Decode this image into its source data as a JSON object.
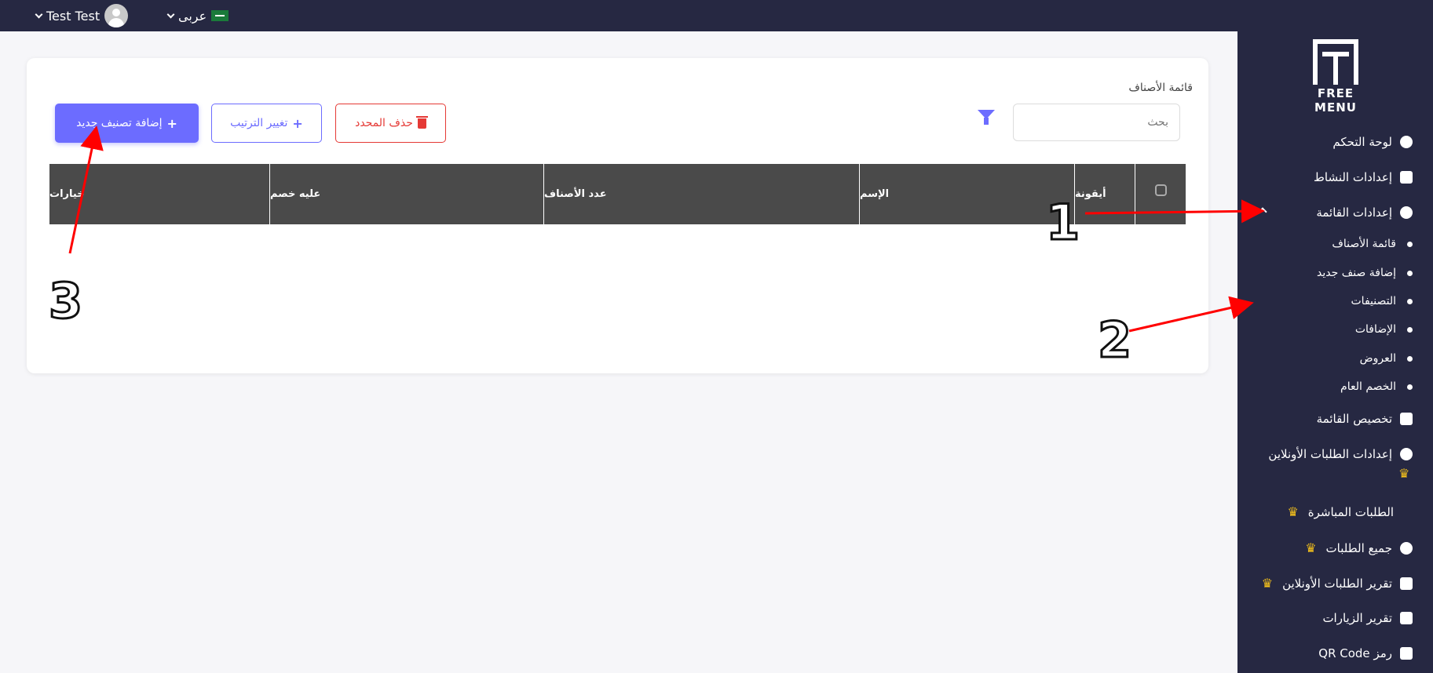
{
  "topbar": {
    "user_name": "Test Test",
    "language": "عربى"
  },
  "sidebar": {
    "logo_text_line1": "FREE",
    "logo_text_line2": "MENU",
    "items": [
      {
        "label": "لوحة التحكم",
        "icon": "dashboard-icon"
      },
      {
        "label": "إعدادات النشاط",
        "icon": "briefcase-icon"
      },
      {
        "label": "إعدادات القائمة",
        "icon": "database-icon"
      }
    ],
    "sub_items": [
      {
        "label": "قائمة الأصناف"
      },
      {
        "label": "إضافة صنف جديد"
      },
      {
        "label": "التصنيفات"
      },
      {
        "label": "الإضافات"
      },
      {
        "label": "العروض"
      },
      {
        "label": "الخصم العام"
      }
    ],
    "items2": [
      {
        "label": "تخصيص القائمة",
        "icon": "image-icon"
      },
      {
        "label": "إعدادات الطلبات الأونلاين",
        "icon": "telegram-icon",
        "premium": true
      },
      {
        "label": "الطلبات المباشرة",
        "premium": true
      },
      {
        "label": "جميع الطلبات",
        "icon": "money-icon",
        "premium": true
      },
      {
        "label": "تقرير الطلبات الأونلاين",
        "icon": "chart-icon",
        "premium": true
      },
      {
        "label": "تقرير الزيارات",
        "icon": "chart-icon"
      },
      {
        "label": "رمز QR Code",
        "icon": "qrcode-icon"
      }
    ],
    "crown_glyph": "♛"
  },
  "main": {
    "title": "قائمة الأصناف",
    "search_placeholder": "بحث",
    "buttons": {
      "add": "إضافة تصنيف جديد",
      "order": "تغيير الترتيب",
      "delete": "حذف المحدد"
    },
    "table_headers": {
      "options": "خيارات",
      "discount": "عليه خصم",
      "count": "عدد الأصناف",
      "name": "الإسم",
      "icon": "أيقونة"
    }
  },
  "annotations": {
    "colors": {
      "arrow": "#ff0000"
    },
    "labels": [
      "1",
      "2",
      "3"
    ]
  }
}
